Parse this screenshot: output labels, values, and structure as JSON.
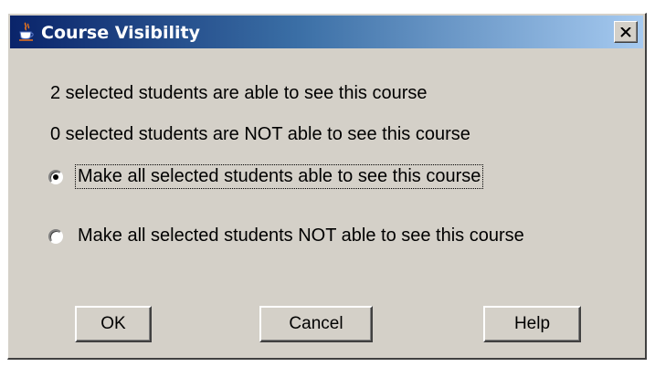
{
  "window": {
    "title": "Course Visibility",
    "app_icon": "java-cup-icon",
    "close_icon": "close-icon"
  },
  "messages": {
    "able": "2 selected students are able to see this course",
    "not_able": "0 selected students are NOT able to see this course"
  },
  "options": [
    {
      "label": "Make all selected students able to see this course",
      "selected": true
    },
    {
      "label": "Make all selected students NOT able to see this course",
      "selected": false
    }
  ],
  "buttons": {
    "ok": "OK",
    "cancel": "Cancel",
    "help": "Help"
  },
  "colors": {
    "titlebar_start": "#0a246a",
    "titlebar_end": "#a6caf0",
    "dialog_bg": "#d4d0c8"
  }
}
